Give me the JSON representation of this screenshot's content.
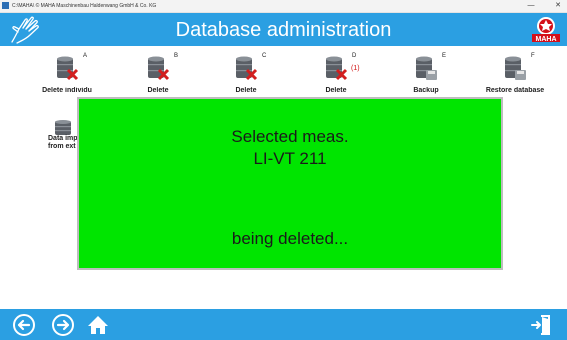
{
  "window": {
    "title": "C:\\MAHA\\  © MAHA Maschinenbau Haldenwang GmbH & Co. KG",
    "minimize_glyph": "—",
    "close_glyph": "✕"
  },
  "header": {
    "title": "Database administration",
    "logo_text": "MAHA",
    "accent_color": "#2b9fe2"
  },
  "tiles": [
    {
      "key": "A",
      "label": "Delete individu",
      "icon": "database-delete-icon"
    },
    {
      "key": "B",
      "label": "Delete",
      "icon": "database-delete-icon"
    },
    {
      "key": "C",
      "label": "Delete",
      "icon": "database-delete-icon"
    },
    {
      "key": "D",
      "label": "Delete",
      "icon": "database-delete-icon",
      "count": "(1)"
    },
    {
      "key": "E",
      "label": "Backup",
      "icon": "database-backup-icon"
    },
    {
      "key": "F",
      "label": "Restore database",
      "icon": "database-restore-icon"
    }
  ],
  "import_tile": {
    "label": "Data imp\nfrom ext",
    "icon": "database-import-icon"
  },
  "dialog": {
    "line1": "Selected meas.",
    "line2": "LI-VT 211",
    "line3": "being deleted...",
    "background": "#00e500"
  },
  "footer": {
    "back": "back-icon",
    "forward": "forward-icon",
    "home": "home-icon",
    "exit": "exit-icon"
  }
}
